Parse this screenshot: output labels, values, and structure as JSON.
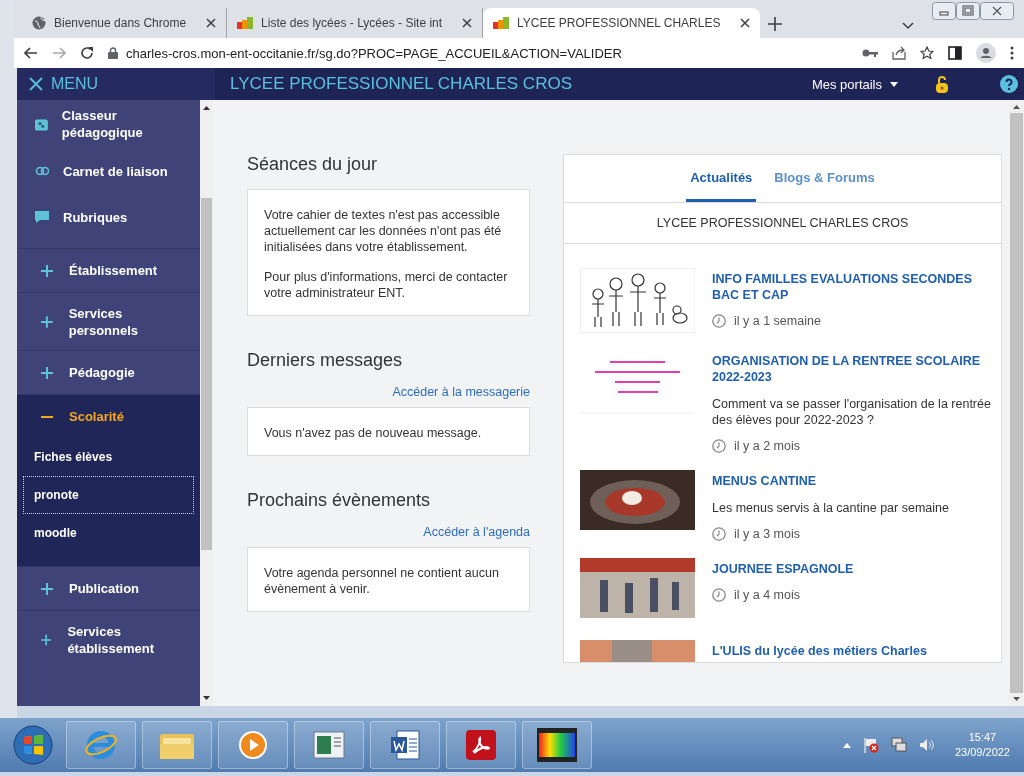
{
  "browser": {
    "tabs": [
      {
        "title": "Bienvenue dans Chrome",
        "selected": false
      },
      {
        "title": "Liste des lycées - Lycées - Site int",
        "selected": false
      },
      {
        "title": "LYCEE PROFESSIONNEL CHARLES",
        "selected": true
      }
    ],
    "url": "charles-cros.mon-ent-occitanie.fr/sg.do?PROC=PAGE_ACCUEIL&ACTION=VALIDER"
  },
  "header": {
    "menu_label": "MENU",
    "title": "LYCEE PROFESSIONNEL CHARLES CROS",
    "portals": "Mes portails"
  },
  "sidebar": {
    "items": [
      {
        "kind": "app",
        "label": "Classeur pédagogique"
      },
      {
        "kind": "app",
        "label": "Carnet de liaison"
      },
      {
        "kind": "app",
        "label": "Rubriques"
      },
      {
        "kind": "section",
        "label": "Établissement",
        "expanded": false
      },
      {
        "kind": "section",
        "label": "Services personnels",
        "expanded": false
      },
      {
        "kind": "section",
        "label": "Pédagogie",
        "expanded": false
      },
      {
        "kind": "section",
        "label": "Scolarité",
        "expanded": true,
        "children": [
          {
            "label": "Fiches élèves",
            "focused": false
          },
          {
            "label": "pronote",
            "focused": true
          },
          {
            "label": "moodle",
            "focused": false
          }
        ]
      },
      {
        "kind": "section",
        "label": "Publication",
        "expanded": false
      },
      {
        "kind": "section",
        "label": "Services établissement",
        "expanded": false
      }
    ]
  },
  "widgets": [
    {
      "title": "Séances du jour",
      "paragraphs": [
        "Votre cahier de textes n'est pas accessible actuellement car les données n'ont pas été initialisées dans votre établissement.",
        "Pour plus d'informations, merci de contacter votre administrateur ENT."
      ]
    },
    {
      "title": "Derniers messages",
      "link": "Accéder à la messagerie",
      "paragraphs": [
        "Vous n'avez pas de nouveau message."
      ]
    },
    {
      "title": "Prochains évènements",
      "link": "Accéder à l'agenda",
      "paragraphs": [
        "Votre agenda personnel ne contient aucun évènement à venir."
      ]
    }
  ],
  "news_panel": {
    "tabs": [
      {
        "label": "Actualités",
        "selected": true
      },
      {
        "label": "Blogs & Forums",
        "selected": false
      }
    ],
    "subtitle": "LYCEE PROFESSIONNEL CHARLES CROS",
    "items": [
      {
        "kind": "drawing",
        "title": "INFO FAMILLES EVALUATIONS SECONDES BAC ET CAP",
        "time": "il y a 1 semaine"
      },
      {
        "kind": "poster",
        "title": "ORGANISATION DE LA RENTREE SCOLAIRE 2022-2023",
        "description": "Comment va se passer l'organisation de la rentrée des élèves pour 2022-2023 ?",
        "time": "il y a 2 mois"
      },
      {
        "kind": "food",
        "title": "MENUS CANTINE",
        "description": "Les menus servis à la cantine par semaine",
        "time": "il y a 3 mois"
      },
      {
        "kind": "crowd",
        "title": "JOURNEE ESPAGNOLE",
        "time": "il y a 4 mois"
      },
      {
        "kind": "group",
        "title": "L'ULIS du lycée des métiers Charles"
      }
    ]
  },
  "taskbar": {
    "time": "15:47",
    "date": "23/09/2022"
  }
}
